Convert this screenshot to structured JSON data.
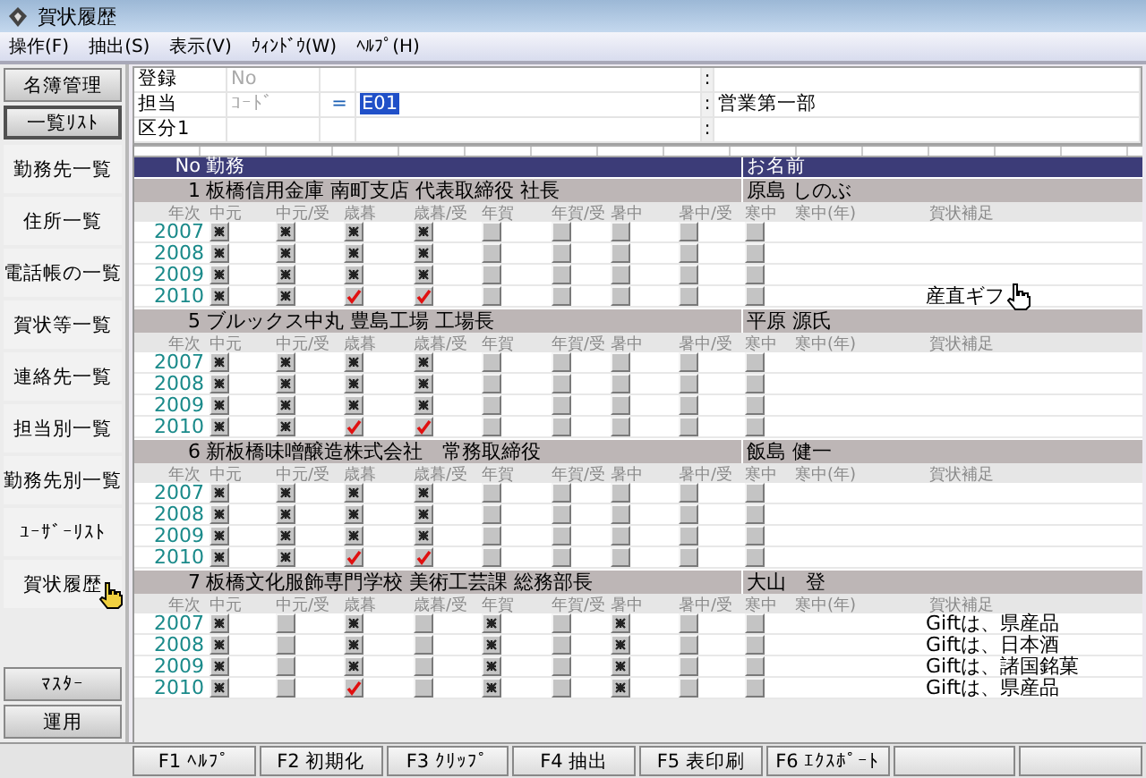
{
  "window": {
    "title": "賀状履歴"
  },
  "menu": [
    "操作(F)",
    "抽出(S)",
    "表示(V)",
    "ｳｨﾝﾄﾞｳ(W)",
    "ﾍﾙﾌﾟ(H)"
  ],
  "sidebar": {
    "top_buttons": [
      {
        "label": "名簿管理",
        "focused": false
      },
      {
        "label": "一覧ﾘｽﾄ",
        "focused": true
      }
    ],
    "items": [
      "勤務先一覧",
      "住所一覧",
      "電話帳の一覧",
      "賀状等一覧",
      "連絡先一覧",
      "担当別一覧",
      "勤務先別一覧",
      "ﾕｰｻﾞｰﾘｽﾄ",
      "賀状履歴"
    ],
    "bottom_buttons": [
      "ﾏｽﾀｰ",
      "運用"
    ]
  },
  "form": {
    "rows": [
      {
        "label": "登録",
        "key": "No",
        "separator": ":"
      },
      {
        "label": "担当",
        "key": "ｺｰﾄﾞ",
        "operator": "=",
        "value": "E01",
        "value_selected": true,
        "separator": ":",
        "description": "営業第一部"
      },
      {
        "label": "区分1",
        "separator": ":"
      }
    ]
  },
  "grid": {
    "header": {
      "no": "No",
      "company": "勤務",
      "name": "お名前"
    },
    "records": [
      {
        "no": "1",
        "company": "板橋信用金庫 南町支店 代表取締役 社長",
        "name": "原島 しのぶ",
        "columns": [
          "年次",
          "中元",
          "中元/受",
          "歳暮",
          "歳暮/受",
          "年賀",
          "年賀/受",
          "暑中",
          "暑中/受",
          "寒中",
          "寒中(年)",
          "賀状補足"
        ],
        "years": [
          {
            "year": "2007",
            "marks": [
              {
                "checked": true,
                "done": false
              },
              {
                "checked": true,
                "done": false
              },
              {
                "checked": true,
                "done": false
              },
              {
                "checked": true,
                "done": false
              },
              {
                "checked": false,
                "done": false
              },
              {
                "checked": false,
                "done": false
              },
              {
                "checked": false,
                "done": false
              },
              {
                "checked": false,
                "done": false
              },
              {
                "checked": false,
                "done": false
              }
            ]
          },
          {
            "year": "2008",
            "marks": [
              {
                "checked": true,
                "done": false
              },
              {
                "checked": true,
                "done": false
              },
              {
                "checked": true,
                "done": false
              },
              {
                "checked": true,
                "done": false
              },
              {
                "checked": false,
                "done": false
              },
              {
                "checked": false,
                "done": false
              },
              {
                "checked": false,
                "done": false
              },
              {
                "checked": false,
                "done": false
              },
              {
                "checked": false,
                "done": false
              }
            ]
          },
          {
            "year": "2009",
            "marks": [
              {
                "checked": true,
                "done": false
              },
              {
                "checked": true,
                "done": false
              },
              {
                "checked": true,
                "done": false
              },
              {
                "checked": true,
                "done": false
              },
              {
                "checked": false,
                "done": false
              },
              {
                "checked": false,
                "done": false
              },
              {
                "checked": false,
                "done": false
              },
              {
                "checked": false,
                "done": false
              },
              {
                "checked": false,
                "done": false
              }
            ]
          },
          {
            "year": "2010",
            "marks": [
              {
                "checked": true,
                "done": false
              },
              {
                "checked": true,
                "done": false
              },
              {
                "checked": true,
                "done": true
              },
              {
                "checked": true,
                "done": true
              },
              {
                "checked": false,
                "done": false
              },
              {
                "checked": false,
                "done": false
              },
              {
                "checked": false,
                "done": false
              },
              {
                "checked": false,
                "done": false
              },
              {
                "checked": false,
                "done": false
              }
            ],
            "note": "産直ギフ"
          }
        ]
      },
      {
        "no": "5",
        "company": "ブルックス中丸 豊島工場 工場長",
        "name": "平原 源氏",
        "columns": [
          "年次",
          "中元",
          "中元/受",
          "歳暮",
          "歳暮/受",
          "年賀",
          "年賀/受",
          "暑中",
          "暑中/受",
          "寒中",
          "寒中(年)",
          "賀状補足"
        ],
        "years": [
          {
            "year": "2007",
            "marks": [
              {
                "checked": true,
                "done": false
              },
              {
                "checked": true,
                "done": false
              },
              {
                "checked": true,
                "done": false
              },
              {
                "checked": true,
                "done": false
              },
              {
                "checked": false,
                "done": false
              },
              {
                "checked": false,
                "done": false
              },
              {
                "checked": false,
                "done": false
              },
              {
                "checked": false,
                "done": false
              },
              {
                "checked": false,
                "done": false
              }
            ]
          },
          {
            "year": "2008",
            "marks": [
              {
                "checked": true,
                "done": false
              },
              {
                "checked": true,
                "done": false
              },
              {
                "checked": true,
                "done": false
              },
              {
                "checked": true,
                "done": false
              },
              {
                "checked": false,
                "done": false
              },
              {
                "checked": false,
                "done": false
              },
              {
                "checked": false,
                "done": false
              },
              {
                "checked": false,
                "done": false
              },
              {
                "checked": false,
                "done": false
              }
            ]
          },
          {
            "year": "2009",
            "marks": [
              {
                "checked": true,
                "done": false
              },
              {
                "checked": true,
                "done": false
              },
              {
                "checked": true,
                "done": false
              },
              {
                "checked": true,
                "done": false
              },
              {
                "checked": false,
                "done": false
              },
              {
                "checked": false,
                "done": false
              },
              {
                "checked": false,
                "done": false
              },
              {
                "checked": false,
                "done": false
              },
              {
                "checked": false,
                "done": false
              }
            ]
          },
          {
            "year": "2010",
            "marks": [
              {
                "checked": true,
                "done": false
              },
              {
                "checked": true,
                "done": false
              },
              {
                "checked": true,
                "done": true
              },
              {
                "checked": true,
                "done": true
              },
              {
                "checked": false,
                "done": false
              },
              {
                "checked": false,
                "done": false
              },
              {
                "checked": false,
                "done": false
              },
              {
                "checked": false,
                "done": false
              },
              {
                "checked": false,
                "done": false
              }
            ]
          }
        ]
      },
      {
        "no": "6",
        "company": "新板橋味噌醸造株式会社　常務取締役",
        "name": "飯島 健一",
        "columns": [
          "年次",
          "中元",
          "中元/受",
          "歳暮",
          "歳暮/受",
          "年賀",
          "年賀/受",
          "暑中",
          "暑中/受",
          "寒中",
          "寒中(年)",
          "賀状補足"
        ],
        "years": [
          {
            "year": "2007",
            "marks": [
              {
                "checked": true,
                "done": false
              },
              {
                "checked": true,
                "done": false
              },
              {
                "checked": true,
                "done": false
              },
              {
                "checked": true,
                "done": false
              },
              {
                "checked": false,
                "done": false
              },
              {
                "checked": false,
                "done": false
              },
              {
                "checked": false,
                "done": false
              },
              {
                "checked": false,
                "done": false
              },
              {
                "checked": false,
                "done": false
              }
            ]
          },
          {
            "year": "2008",
            "marks": [
              {
                "checked": true,
                "done": false
              },
              {
                "checked": true,
                "done": false
              },
              {
                "checked": true,
                "done": false
              },
              {
                "checked": true,
                "done": false
              },
              {
                "checked": false,
                "done": false
              },
              {
                "checked": false,
                "done": false
              },
              {
                "checked": false,
                "done": false
              },
              {
                "checked": false,
                "done": false
              },
              {
                "checked": false,
                "done": false
              }
            ]
          },
          {
            "year": "2009",
            "marks": [
              {
                "checked": true,
                "done": false
              },
              {
                "checked": true,
                "done": false
              },
              {
                "checked": true,
                "done": false
              },
              {
                "checked": true,
                "done": false
              },
              {
                "checked": false,
                "done": false
              },
              {
                "checked": false,
                "done": false
              },
              {
                "checked": false,
                "done": false
              },
              {
                "checked": false,
                "done": false
              },
              {
                "checked": false,
                "done": false
              }
            ]
          },
          {
            "year": "2010",
            "marks": [
              {
                "checked": true,
                "done": false
              },
              {
                "checked": true,
                "done": false
              },
              {
                "checked": true,
                "done": true
              },
              {
                "checked": true,
                "done": true
              },
              {
                "checked": false,
                "done": false
              },
              {
                "checked": false,
                "done": false
              },
              {
                "checked": false,
                "done": false
              },
              {
                "checked": false,
                "done": false
              },
              {
                "checked": false,
                "done": false
              }
            ]
          }
        ]
      },
      {
        "no": "7",
        "company": "板橋文化服飾専門学校 美術工芸課 総務部長",
        "name": "大山　登",
        "columns": [
          "年次",
          "中元",
          "中元/受",
          "歳暮",
          "歳暮/受",
          "年賀",
          "年賀/受",
          "暑中",
          "暑中/受",
          "寒中",
          "寒中(年)",
          "賀状補足"
        ],
        "years": [
          {
            "year": "2007",
            "marks": [
              {
                "checked": true,
                "done": false
              },
              {
                "checked": false,
                "done": false
              },
              {
                "checked": true,
                "done": false
              },
              {
                "checked": false,
                "done": false
              },
              {
                "checked": true,
                "done": false
              },
              {
                "checked": false,
                "done": false
              },
              {
                "checked": true,
                "done": false
              },
              {
                "checked": false,
                "done": false
              },
              {
                "checked": false,
                "done": false
              }
            ],
            "note": "Giftは、県産品"
          },
          {
            "year": "2008",
            "marks": [
              {
                "checked": true,
                "done": false
              },
              {
                "checked": false,
                "done": false
              },
              {
                "checked": true,
                "done": false
              },
              {
                "checked": false,
                "done": false
              },
              {
                "checked": true,
                "done": false
              },
              {
                "checked": false,
                "done": false
              },
              {
                "checked": true,
                "done": false
              },
              {
                "checked": false,
                "done": false
              },
              {
                "checked": false,
                "done": false
              }
            ],
            "note": "Giftは、日本酒"
          },
          {
            "year": "2009",
            "marks": [
              {
                "checked": true,
                "done": false
              },
              {
                "checked": false,
                "done": false
              },
              {
                "checked": true,
                "done": false
              },
              {
                "checked": false,
                "done": false
              },
              {
                "checked": true,
                "done": false
              },
              {
                "checked": false,
                "done": false
              },
              {
                "checked": true,
                "done": false
              },
              {
                "checked": false,
                "done": false
              },
              {
                "checked": false,
                "done": false
              }
            ],
            "note": "Giftは、諸国銘菓"
          },
          {
            "year": "2010",
            "marks": [
              {
                "checked": true,
                "done": false
              },
              {
                "checked": false,
                "done": false
              },
              {
                "checked": true,
                "done": true
              },
              {
                "checked": false,
                "done": false
              },
              {
                "checked": true,
                "done": false
              },
              {
                "checked": false,
                "done": false
              },
              {
                "checked": true,
                "done": false
              },
              {
                "checked": false,
                "done": false
              },
              {
                "checked": false,
                "done": false
              }
            ],
            "note": "Giftは、県産品"
          }
        ]
      }
    ]
  },
  "footer": {
    "buttons": [
      "F1 ﾍﾙﾌﾟ",
      "F2 初期化",
      "F3 ｸﾘｯﾌﾟ",
      "F4 抽出",
      "F5 表印刷",
      "F6 ｴｸｽﾎﾟｰﾄ"
    ]
  }
}
